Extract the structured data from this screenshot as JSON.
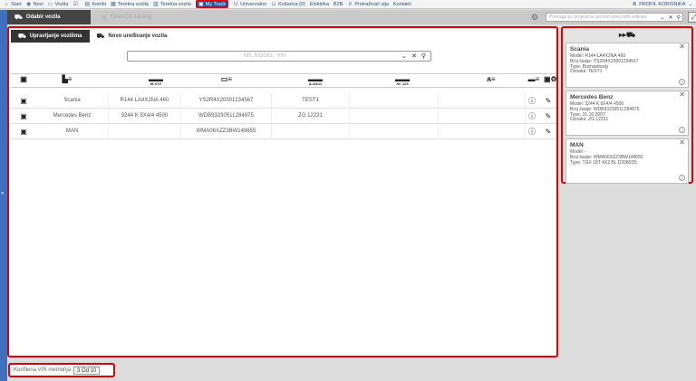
{
  "nav": {
    "items": [
      {
        "icon": "home-icon",
        "glyph": "⌂",
        "label": "Start"
      },
      {
        "icon": "new-icon",
        "glyph": "◉",
        "label": "Novi"
      },
      {
        "icon": "car-icon",
        "glyph": "▭",
        "label": "Vozila"
      },
      {
        "icon": "checkbox-icon",
        "glyph": "☑",
        "label": ""
      },
      {
        "icon": "van-icon",
        "glyph": "▤",
        "label": "Kombi"
      },
      {
        "icon": "truck-icon",
        "glyph": "▦",
        "label": "Teretna vozila"
      },
      {
        "icon": "tractor-icon",
        "glyph": "▥",
        "label": "Teretna vozila"
      },
      {
        "icon": "mytruck-icon",
        "glyph": "▣",
        "label": "My Truck"
      },
      {
        "icon": "universal-icon",
        "glyph": "U",
        "label": "Univerzalno"
      },
      {
        "icon": "cart-icon",
        "glyph": "⊔",
        "label": "Košarica (0)"
      },
      {
        "icon": "electro-icon",
        "glyph": "",
        "label": "Elektrika"
      },
      {
        "icon": "b2b-icon",
        "glyph": "",
        "label": "B2B"
      },
      {
        "icon": "oil-icon",
        "glyph": "♯",
        "label": "Pretraživač ulja"
      },
      {
        "icon": "contact-icon",
        "glyph": "",
        "label": "Kontakti"
      }
    ],
    "active_index": 7,
    "profile_label": "PROFIL KORISNIKA"
  },
  "subbar": {
    "dark_tab": "Odabir vozila",
    "grey_tab": "Električni katalog",
    "search_placeholder": "Pretraga po brojevima upisnim preuzetih artikala",
    "corner_glyph": "⤢"
  },
  "main": {
    "tabs": [
      {
        "label": "Upravljanje vozilima",
        "active": true
      },
      {
        "label": "Novo uređivanje vozila",
        "active": false
      }
    ],
    "search_placeholder": "NR, MODEL, VIN",
    "headers": [
      {
        "glyph": "▣",
        "sub": ""
      },
      {
        "glyph": "▙≡",
        "sub": ""
      },
      {
        "glyph": "▬▬",
        "sub": "M-XYZ"
      },
      {
        "glyph": "▭≡",
        "sub": ""
      },
      {
        "glyph": "▬▬",
        "sub": "A-AA11"
      },
      {
        "glyph": "▬▬",
        "sub": "Nr. 123"
      },
      {
        "glyph": "ጸ≡",
        "sub": ""
      },
      {
        "glyph": "▬≡",
        "sub": ""
      },
      {
        "glyph": "▣⚙",
        "sub": ""
      }
    ],
    "rows": [
      {
        "make": "Scania",
        "model": "R144 LA4X2NA 460",
        "vin": "YS2R4X20001234567",
        "plate": "TEST1",
        "nr": "",
        "owner": ""
      },
      {
        "make": "Mercedes Benz",
        "model": "3244 K 8X4/4 4500",
        "vin": "WDB9323051L284875",
        "plate": "ZG 12231",
        "nr": "",
        "owner": ""
      },
      {
        "make": "MAN",
        "model": "",
        "vin": "WMA06XZZ3BW148655",
        "plate": "",
        "nr": "",
        "owner": ""
      }
    ]
  },
  "footer": {
    "label": "Konfilena VIN memorija",
    "button": "3 Od 10"
  },
  "right_panel": {
    "cards": [
      {
        "name": "Scania",
        "lines": [
          "Model: R144 LA4X2NA 460",
          "Broj šasije: YS2R4X20001234567",
          "Type: Boxivanbody",
          "Oznaka: TEST1"
        ]
      },
      {
        "name": "Mercedes Benz",
        "lines": [
          "Model: 3244 K 8X4/4 4500",
          "Broj šasije: WDB9323051L284875",
          "Type: 31.10.2007",
          "Oznaka: ZG 12231"
        ]
      },
      {
        "name": "MAN",
        "lines": [
          "Model: -",
          "Broj šasije: WMA06XZZ3BW148655",
          "Type: TGX 18T 4X2 BL D2080D5."
        ]
      }
    ]
  }
}
